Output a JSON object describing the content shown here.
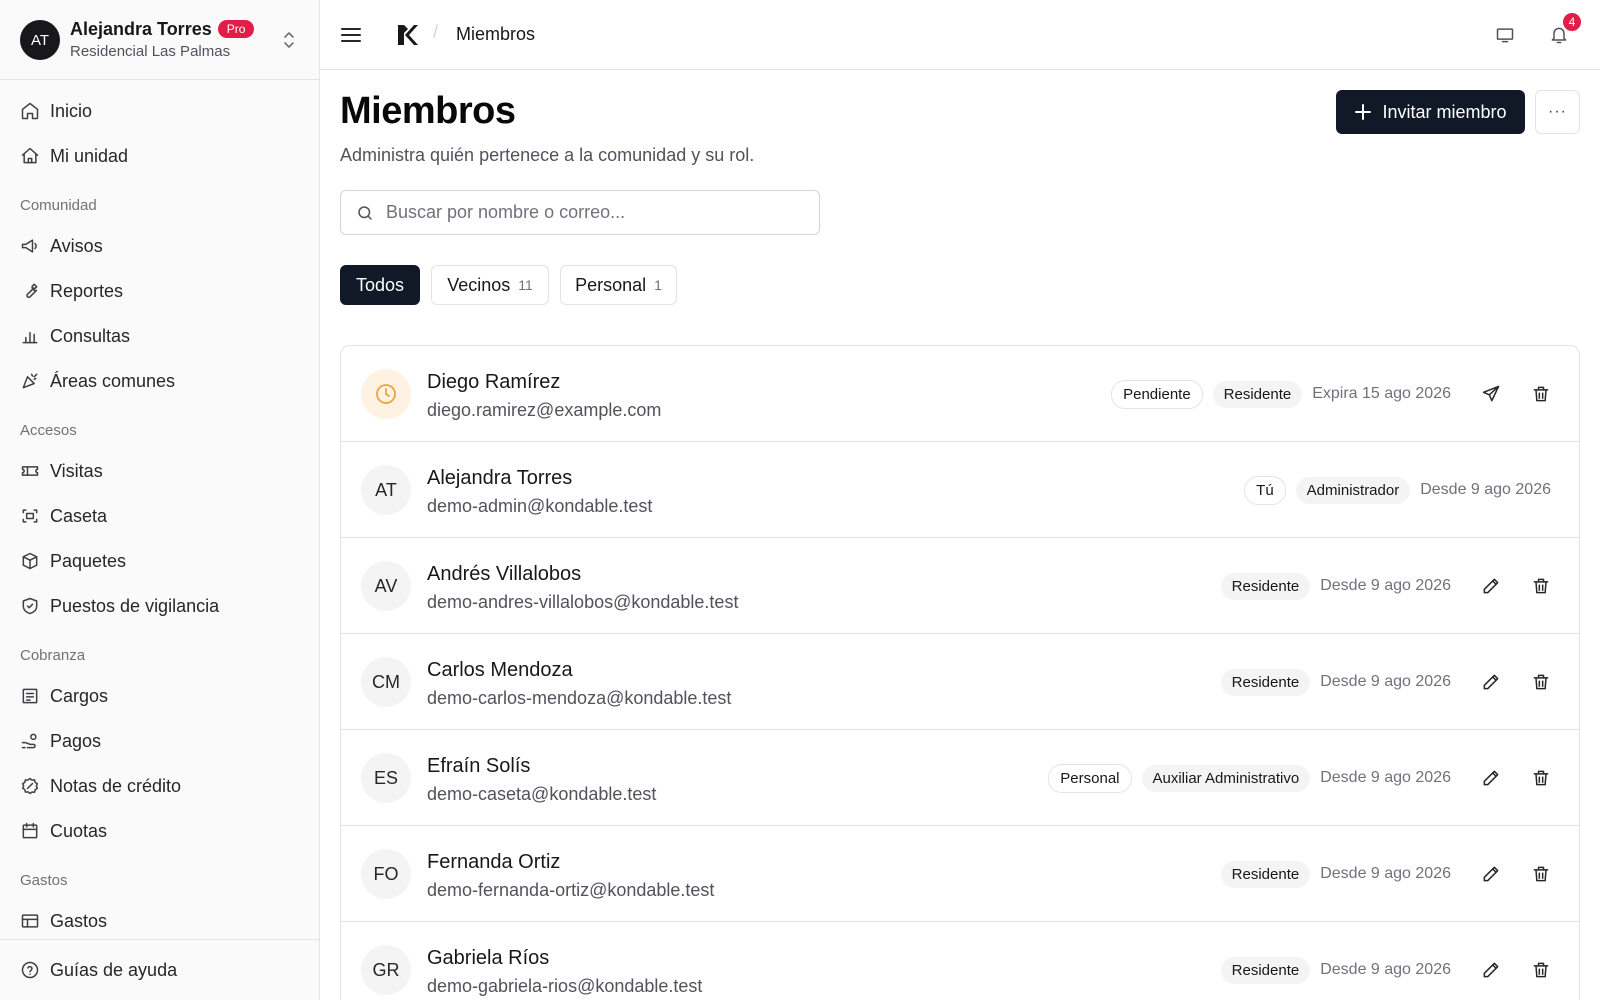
{
  "account": {
    "initials": "AT",
    "name": "Alejandra Torres",
    "plan": "Pro",
    "organization": "Residencial Las Palmas"
  },
  "nav": {
    "main": [
      {
        "label": "Inicio",
        "icon": "home-icon"
      },
      {
        "label": "Mi unidad",
        "icon": "house-icon"
      }
    ],
    "sections": [
      {
        "title": "Comunidad",
        "items": [
          {
            "label": "Avisos",
            "icon": "megaphone-icon"
          },
          {
            "label": "Reportes",
            "icon": "wrench-icon"
          },
          {
            "label": "Consultas",
            "icon": "bar-chart-icon"
          },
          {
            "label": "Áreas comunes",
            "icon": "party-popper-icon"
          }
        ]
      },
      {
        "title": "Accesos",
        "items": [
          {
            "label": "Visitas",
            "icon": "ticket-icon"
          },
          {
            "label": "Caseta",
            "icon": "scan-icon"
          },
          {
            "label": "Paquetes",
            "icon": "package-icon"
          },
          {
            "label": "Puestos de vigilancia",
            "icon": "shield-check-icon"
          }
        ]
      },
      {
        "title": "Cobranza",
        "items": [
          {
            "label": "Cargos",
            "icon": "receipt-icon"
          },
          {
            "label": "Pagos",
            "icon": "hand-coins-icon"
          },
          {
            "label": "Notas de crédito",
            "icon": "badge-percent-icon"
          },
          {
            "label": "Cuotas",
            "icon": "calendar-icon"
          }
        ]
      },
      {
        "title": "Gastos",
        "items": [
          {
            "label": "Gastos",
            "icon": "spreadsheet-icon"
          }
        ]
      }
    ],
    "footer": {
      "label": "Guías de ayuda",
      "icon": "help-circle-icon"
    }
  },
  "topbar": {
    "breadcrumb": "Miembros",
    "separator": "/",
    "notifications": "4"
  },
  "page": {
    "title": "Miembros",
    "subtitle": "Administra quién pertenece a la comunidad y su rol.",
    "invite_label": "Invitar miembro",
    "more_label": "···"
  },
  "search": {
    "placeholder": "Buscar por nombre o correo...",
    "value": ""
  },
  "tabs": [
    {
      "label": "Todos",
      "count": ""
    },
    {
      "label": "Vecinos",
      "count": "11"
    },
    {
      "label": "Personal",
      "count": "1"
    }
  ],
  "members": [
    {
      "initials": "",
      "pending": true,
      "name": "Diego Ramírez",
      "email": "diego.ramirez@example.com",
      "outline_tag": "Pendiente",
      "role": "Residente",
      "since": "Expira 15 ago 2026",
      "actions": [
        "send",
        "delete"
      ]
    },
    {
      "initials": "AT",
      "pending": false,
      "name": "Alejandra Torres",
      "email": "demo-admin@kondable.test",
      "outline_tag": "Tú",
      "role": "Administrador",
      "since": "Desde 9 ago 2026",
      "actions": []
    },
    {
      "initials": "AV",
      "pending": false,
      "name": "Andrés Villalobos",
      "email": "demo-andres-villalobos@kondable.test",
      "outline_tag": "",
      "role": "Residente",
      "since": "Desde 9 ago 2026",
      "actions": [
        "edit",
        "delete"
      ]
    },
    {
      "initials": "CM",
      "pending": false,
      "name": "Carlos Mendoza",
      "email": "demo-carlos-mendoza@kondable.test",
      "outline_tag": "",
      "role": "Residente",
      "since": "Desde 9 ago 2026",
      "actions": [
        "edit",
        "delete"
      ]
    },
    {
      "initials": "ES",
      "pending": false,
      "name": "Efraín Solís",
      "email": "demo-caseta@kondable.test",
      "outline_tag": "Personal",
      "role": "Auxiliar Administrativo",
      "since": "Desde 9 ago 2026",
      "actions": [
        "edit",
        "delete"
      ]
    },
    {
      "initials": "FO",
      "pending": false,
      "name": "Fernanda Ortiz",
      "email": "demo-fernanda-ortiz@kondable.test",
      "outline_tag": "",
      "role": "Residente",
      "since": "Desde 9 ago 2026",
      "actions": [
        "edit",
        "delete"
      ]
    },
    {
      "initials": "GR",
      "pending": false,
      "name": "Gabriela Ríos",
      "email": "demo-gabriela-rios@kondable.test",
      "outline_tag": "",
      "role": "Residente",
      "since": "Desde 9 ago 2026",
      "actions": [
        "edit",
        "delete"
      ]
    }
  ],
  "colors": {
    "primary": "#111827",
    "accent_badge": "#e11d48",
    "pending": "#e8a33d",
    "border": "#e4e4e7"
  }
}
